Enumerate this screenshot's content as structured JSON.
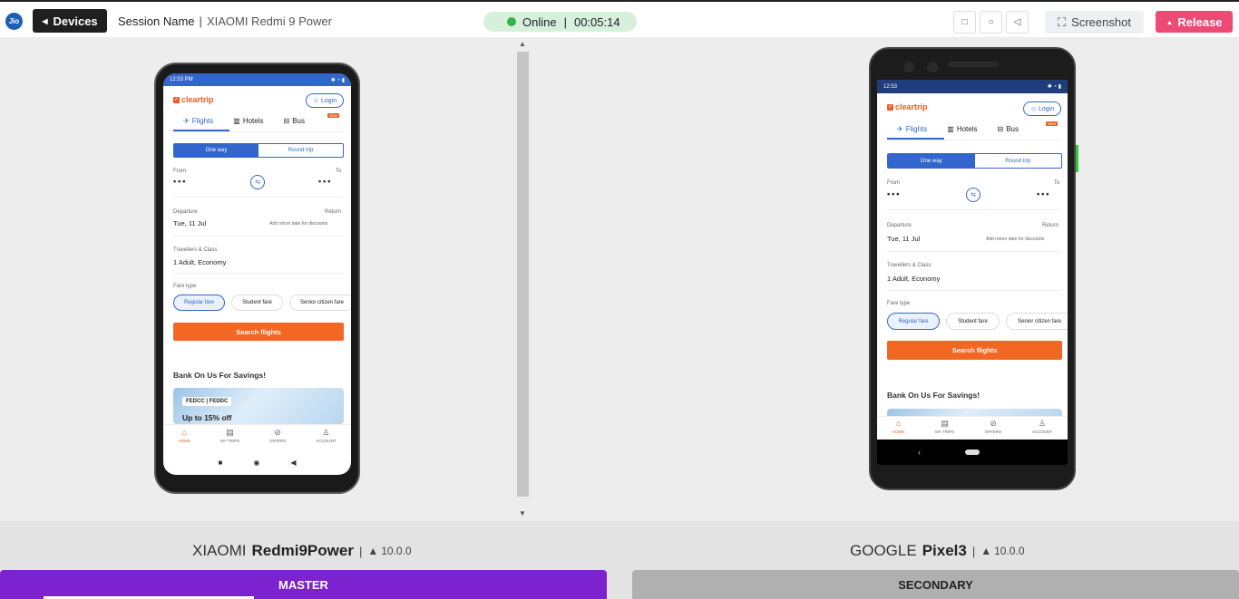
{
  "topbar": {
    "logo": "Jio",
    "devices_label": "Devices",
    "session_label": "Session Name",
    "session_sep": "|",
    "session_device": "XIAOMI Redmi 9 Power",
    "status": "Online",
    "status_sep": "|",
    "timer": "00:05:14",
    "screenshot_label": "Screenshot",
    "release_label": "Release"
  },
  "colors": {
    "master": "#7d22cf",
    "secondary": "#b0b0b0",
    "release": "#ee4a76",
    "online": "#36b34a",
    "brand_orange": "#f15a22",
    "brand_blue": "#3366cc"
  },
  "devices": [
    {
      "brand": "XIAOMI",
      "model": "Redmi9Power",
      "os_version": "10.0.0",
      "role": "MASTER",
      "status_time": "12:53 PM"
    },
    {
      "brand": "GOOGLE",
      "model": "Pixel3",
      "os_version": "10.0.0",
      "role": "SECONDARY",
      "status_time": "12:53"
    }
  ],
  "app": {
    "brand": "cleartrip",
    "login": "Login",
    "tabs": [
      "Flights",
      "Hotels",
      "Bus"
    ],
    "bus_badge": "NEW",
    "trip_types": [
      "One way",
      "Round trip"
    ],
    "from_label": "From",
    "to_label": "To",
    "from_value": "•••",
    "to_value": "•••",
    "departure_label": "Departure",
    "departure_value": "Tue, 11 Jul",
    "return_label": "Return",
    "return_hint": "Add return date for discounts",
    "travellers_label": "Travellers & Class",
    "travellers_value": "1 Adult, Economy",
    "fare_type_label": "Fare type",
    "fares": [
      "Regular fare",
      "Student fare",
      "Senior citizen fare"
    ],
    "search_button": "Search flights",
    "bank_heading": "Bank On Us For Savings!",
    "banner_tag": "FEDCC | FEDDC",
    "banner_offer": "Up to 15% off",
    "bottom_nav": [
      "HOME",
      "MY TRIPS",
      "OFFERS",
      "ACCOUNT"
    ]
  }
}
